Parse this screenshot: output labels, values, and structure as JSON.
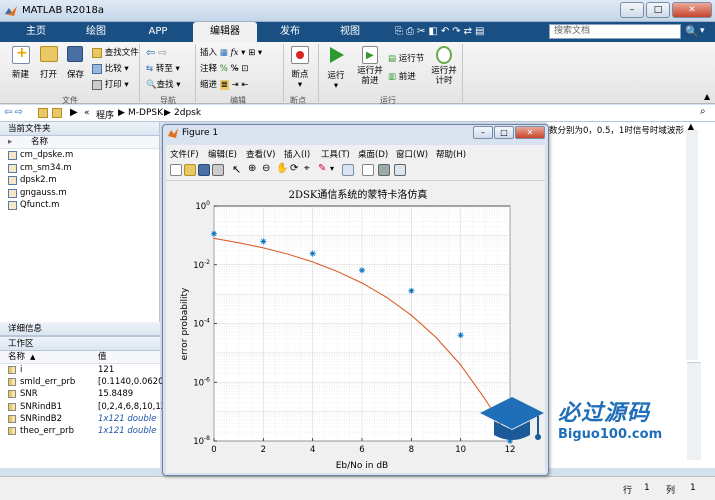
{
  "window": {
    "title": "MATLAB R2018a",
    "minimize": "–",
    "maximize": "□",
    "close": "✕"
  },
  "tabs": [
    "主页",
    "绘图",
    "APP",
    "编辑器",
    "发布",
    "视图"
  ],
  "search": {
    "placeholder": "搜索文档"
  },
  "ribbon": {
    "file": {
      "new": "新建",
      "open": "打开",
      "save": "保存",
      "find_files": "查找文件",
      "compare": "比较",
      "print": "打印",
      "section": "文件"
    },
    "navigate": {
      "goto": "转至",
      "find": "查找",
      "section": "导航"
    },
    "edit": {
      "insert": "插入",
      "comment": "注释",
      "indent": "缩进",
      "section": "编辑"
    },
    "breakpoints": {
      "breakpoints": "断点",
      "section": "断点"
    },
    "run": {
      "run": "运行",
      "run_advance": "运行并\n前进",
      "run_section": "运行节",
      "advance": "前进",
      "run_time": "运行并\n计时",
      "section": "运行"
    }
  },
  "address": {
    "path": [
      "«",
      "程序",
      "M-DPSK",
      "2dpsk"
    ]
  },
  "current_folder": {
    "title": "当前文件夹",
    "col_name": "名称",
    "files": [
      "cm_dpske.m",
      "cm_sm34.m",
      "dpsk2.m",
      "gngauss.m",
      "Qfunct.m"
    ]
  },
  "details": {
    "title": "详细信息"
  },
  "workspace": {
    "title": "工作区",
    "col_name": "名称",
    "col_value": "值",
    "rows": [
      {
        "name": "i",
        "value": "121",
        "italic": false
      },
      {
        "name": "smld_err_prb",
        "value": "[0.1140,0.0620,0.",
        "italic": false
      },
      {
        "name": "SNR",
        "value": "15.8489",
        "italic": false
      },
      {
        "name": "SNRindB1",
        "value": "[0,2,4,6,8,10,12]",
        "italic": false
      },
      {
        "name": "SNRindB2",
        "value": "1x121 double",
        "italic": true
      },
      {
        "name": "theo_err_prb",
        "value": "1x121 double",
        "italic": true
      }
    ]
  },
  "command_window": {
    "text": "数分别为0，0.5，1时信号时域波形"
  },
  "status": {
    "row_label": "行",
    "row": "1",
    "col_label": "列",
    "col": "1"
  },
  "figure": {
    "title": "Figure 1",
    "menu": [
      "文件(F)",
      "编辑(E)",
      "查看(V)",
      "插入(I)",
      "工具(T)",
      "桌面(D)",
      "窗口(W)",
      "帮助(H)"
    ]
  },
  "watermark": {
    "brand": "必过源码",
    "url": "Biguo100.com"
  },
  "colors": {
    "accent": "#1a4f84",
    "theory_curve": "#d95319",
    "sim_points": "#0072bd"
  },
  "chart_data": {
    "type": "line",
    "title": "2DSK通信系统的蒙特卡洛仿真",
    "xlabel": "Eb/No in dB",
    "ylabel": "error probability",
    "xlim": [
      0,
      12
    ],
    "ylim": [
      1e-08,
      1
    ],
    "yscale": "log",
    "grid": true,
    "xticks": [
      "0",
      "2",
      "4",
      "6",
      "8",
      "10",
      "12"
    ],
    "yticks": [
      {
        "base": "10",
        "exp": "0"
      },
      {
        "base": "10",
        "exp": "-2"
      },
      {
        "base": "10",
        "exp": "-4"
      },
      {
        "base": "10",
        "exp": "-6"
      },
      {
        "base": "10",
        "exp": "-8"
      }
    ],
    "series": [
      {
        "type": "scatter",
        "marker": "*",
        "x": [
          0,
          2,
          4,
          6,
          8,
          10,
          12
        ],
        "y": [
          0.114,
          0.062,
          0.024,
          0.0065,
          0.0013,
          4e-05,
          1e-08
        ]
      },
      {
        "type": "line",
        "x": [
          0,
          1,
          2,
          3,
          4,
          5,
          6,
          7,
          8,
          9,
          10,
          11,
          11.5,
          12
        ],
        "y": [
          0.0786,
          0.0563,
          0.0375,
          0.0229,
          0.0125,
          0.00595,
          0.00239,
          0.000773,
          0.000191,
          3.36e-05,
          3.87e-06,
          2.61e-07,
          5.45e-08,
          9e-09
        ]
      }
    ]
  }
}
